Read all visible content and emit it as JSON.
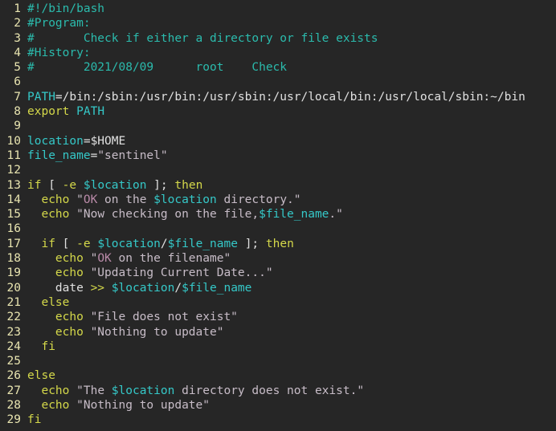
{
  "editor": {
    "background_color": "#262626",
    "gutter_color": "#e8e4b0",
    "language": "bash",
    "total_lines": 29,
    "colors": {
      "comment": "#2bbbad",
      "keyword": "#d4d84a",
      "variable": "#35c8c8",
      "string": "#c7bcc7",
      "plain": "#e0e0e0"
    }
  },
  "lines": [
    {
      "n": "1",
      "tokens": [
        {
          "t": "#!/bin/bash",
          "c": "cmt"
        }
      ]
    },
    {
      "n": "2",
      "tokens": [
        {
          "t": "#Program:",
          "c": "cmt"
        }
      ]
    },
    {
      "n": "3",
      "tokens": [
        {
          "t": "#\tCheck if either a directory or file exists",
          "c": "cmt"
        }
      ]
    },
    {
      "n": "4",
      "tokens": [
        {
          "t": "#History:",
          "c": "cmt"
        }
      ]
    },
    {
      "n": "5",
      "tokens": [
        {
          "t": "#\t2021/08/09\troot\tCheck",
          "c": "cmt"
        }
      ]
    },
    {
      "n": "6",
      "tokens": []
    },
    {
      "n": "7",
      "tokens": [
        {
          "t": "PATH",
          "c": "var"
        },
        {
          "t": "=/bin:/sbin:/usr/bin:/usr/sbin:/usr/local/bin:/usr/local/sbin:~/bin",
          "c": "plain"
        }
      ]
    },
    {
      "n": "8",
      "tokens": [
        {
          "t": "export",
          "c": "kw"
        },
        {
          "t": " ",
          "c": "plain"
        },
        {
          "t": "PATH",
          "c": "var"
        }
      ]
    },
    {
      "n": "9",
      "tokens": []
    },
    {
      "n": "10",
      "tokens": [
        {
          "t": "location",
          "c": "var"
        },
        {
          "t": "=$HOME",
          "c": "plain"
        }
      ]
    },
    {
      "n": "11",
      "tokens": [
        {
          "t": "file_name",
          "c": "var"
        },
        {
          "t": "=",
          "c": "plain"
        },
        {
          "t": "\"sentinel\"",
          "c": "str"
        }
      ]
    },
    {
      "n": "12",
      "tokens": []
    },
    {
      "n": "13",
      "tokens": [
        {
          "t": "if",
          "c": "kw"
        },
        {
          "t": " [ ",
          "c": "plain"
        },
        {
          "t": "-e",
          "c": "kw"
        },
        {
          "t": " ",
          "c": "plain"
        },
        {
          "t": "$location",
          "c": "var"
        },
        {
          "t": " ]; ",
          "c": "plain"
        },
        {
          "t": "then",
          "c": "kw"
        }
      ]
    },
    {
      "n": "14",
      "tokens": [
        {
          "t": "  ",
          "c": "plain"
        },
        {
          "t": "echo",
          "c": "kw"
        },
        {
          "t": " ",
          "c": "plain"
        },
        {
          "t": "\"",
          "c": "str"
        },
        {
          "t": "OK",
          "c": "pnk"
        },
        {
          "t": " on the ",
          "c": "str"
        },
        {
          "t": "$location",
          "c": "var"
        },
        {
          "t": " directory.\"",
          "c": "str"
        }
      ]
    },
    {
      "n": "15",
      "tokens": [
        {
          "t": "  ",
          "c": "plain"
        },
        {
          "t": "echo",
          "c": "kw"
        },
        {
          "t": " ",
          "c": "plain"
        },
        {
          "t": "\"Now checking on the file,",
          "c": "str"
        },
        {
          "t": "$file_name",
          "c": "var"
        },
        {
          "t": ".\"",
          "c": "str"
        }
      ]
    },
    {
      "n": "16",
      "tokens": []
    },
    {
      "n": "17",
      "tokens": [
        {
          "t": "  ",
          "c": "plain"
        },
        {
          "t": "if",
          "c": "kw"
        },
        {
          "t": " [ ",
          "c": "plain"
        },
        {
          "t": "-e",
          "c": "kw"
        },
        {
          "t": " ",
          "c": "plain"
        },
        {
          "t": "$location",
          "c": "var"
        },
        {
          "t": "/",
          "c": "plain"
        },
        {
          "t": "$file_name",
          "c": "var"
        },
        {
          "t": " ]; ",
          "c": "plain"
        },
        {
          "t": "then",
          "c": "kw"
        }
      ]
    },
    {
      "n": "18",
      "tokens": [
        {
          "t": "    ",
          "c": "plain"
        },
        {
          "t": "echo",
          "c": "kw"
        },
        {
          "t": " ",
          "c": "plain"
        },
        {
          "t": "\"",
          "c": "str"
        },
        {
          "t": "OK",
          "c": "pnk"
        },
        {
          "t": " on the filename\"",
          "c": "str"
        }
      ]
    },
    {
      "n": "19",
      "tokens": [
        {
          "t": "    ",
          "c": "plain"
        },
        {
          "t": "echo",
          "c": "kw"
        },
        {
          "t": " ",
          "c": "plain"
        },
        {
          "t": "\"Updating Current Date...\"",
          "c": "str"
        }
      ]
    },
    {
      "n": "20",
      "tokens": [
        {
          "t": "    ",
          "c": "plain"
        },
        {
          "t": "date",
          "c": "plain"
        },
        {
          "t": " ",
          "c": "plain"
        },
        {
          "t": ">>",
          "c": "op"
        },
        {
          "t": " ",
          "c": "plain"
        },
        {
          "t": "$location",
          "c": "var"
        },
        {
          "t": "/",
          "c": "plain"
        },
        {
          "t": "$file_name",
          "c": "var"
        }
      ]
    },
    {
      "n": "21",
      "tokens": [
        {
          "t": "  ",
          "c": "plain"
        },
        {
          "t": "else",
          "c": "kw"
        }
      ]
    },
    {
      "n": "22",
      "tokens": [
        {
          "t": "    ",
          "c": "plain"
        },
        {
          "t": "echo",
          "c": "kw"
        },
        {
          "t": " ",
          "c": "plain"
        },
        {
          "t": "\"File does not exist\"",
          "c": "str"
        }
      ]
    },
    {
      "n": "23",
      "tokens": [
        {
          "t": "    ",
          "c": "plain"
        },
        {
          "t": "echo",
          "c": "kw"
        },
        {
          "t": " ",
          "c": "plain"
        },
        {
          "t": "\"Nothing to update\"",
          "c": "str"
        }
      ]
    },
    {
      "n": "24",
      "tokens": [
        {
          "t": "  ",
          "c": "plain"
        },
        {
          "t": "fi",
          "c": "kw"
        }
      ]
    },
    {
      "n": "25",
      "tokens": []
    },
    {
      "n": "26",
      "tokens": [
        {
          "t": "else",
          "c": "kw"
        }
      ]
    },
    {
      "n": "27",
      "tokens": [
        {
          "t": "  ",
          "c": "plain"
        },
        {
          "t": "echo",
          "c": "kw"
        },
        {
          "t": " ",
          "c": "plain"
        },
        {
          "t": "\"The ",
          "c": "str"
        },
        {
          "t": "$location",
          "c": "var"
        },
        {
          "t": " directory does not exist.\"",
          "c": "str"
        }
      ]
    },
    {
      "n": "28",
      "tokens": [
        {
          "t": "  ",
          "c": "plain"
        },
        {
          "t": "echo",
          "c": "kw"
        },
        {
          "t": " ",
          "c": "plain"
        },
        {
          "t": "\"Nothing to update\"",
          "c": "str"
        }
      ]
    },
    {
      "n": "29",
      "tokens": [
        {
          "t": "fi",
          "c": "kw"
        }
      ]
    }
  ]
}
